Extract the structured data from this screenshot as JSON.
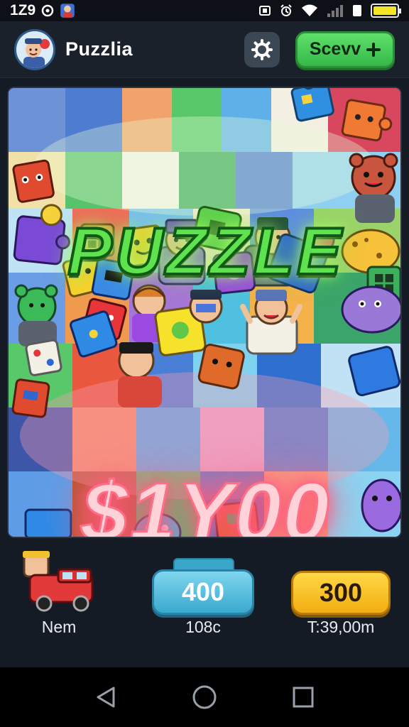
{
  "status_bar": {
    "time": "1Z9",
    "icons": [
      "notification-icon",
      "app-icon",
      "nfc-icon",
      "alarm-icon",
      "wifi-icon",
      "signal-icon",
      "battery-icon"
    ],
    "battery_color": "#f3e52a"
  },
  "header": {
    "app_title": "Puzzlia",
    "settings_icon": "gear-icon",
    "save_label": "Scevv",
    "save_icon": "plus-icon",
    "save_color": "#44c955"
  },
  "board": {
    "title": "PUZZLE",
    "prize": "$1Y00",
    "title_color": "#5ee34f",
    "prize_glow_color": "#ff5b7e"
  },
  "hud": {
    "mode_label": "Nem",
    "level_value": "400",
    "level_label": "108c",
    "coins_value": "300",
    "coins_label": "T:39,00m"
  },
  "nav": {
    "back_icon": "back-triangle-icon",
    "home_icon": "home-circle-icon",
    "recents_icon": "recents-square-icon"
  }
}
